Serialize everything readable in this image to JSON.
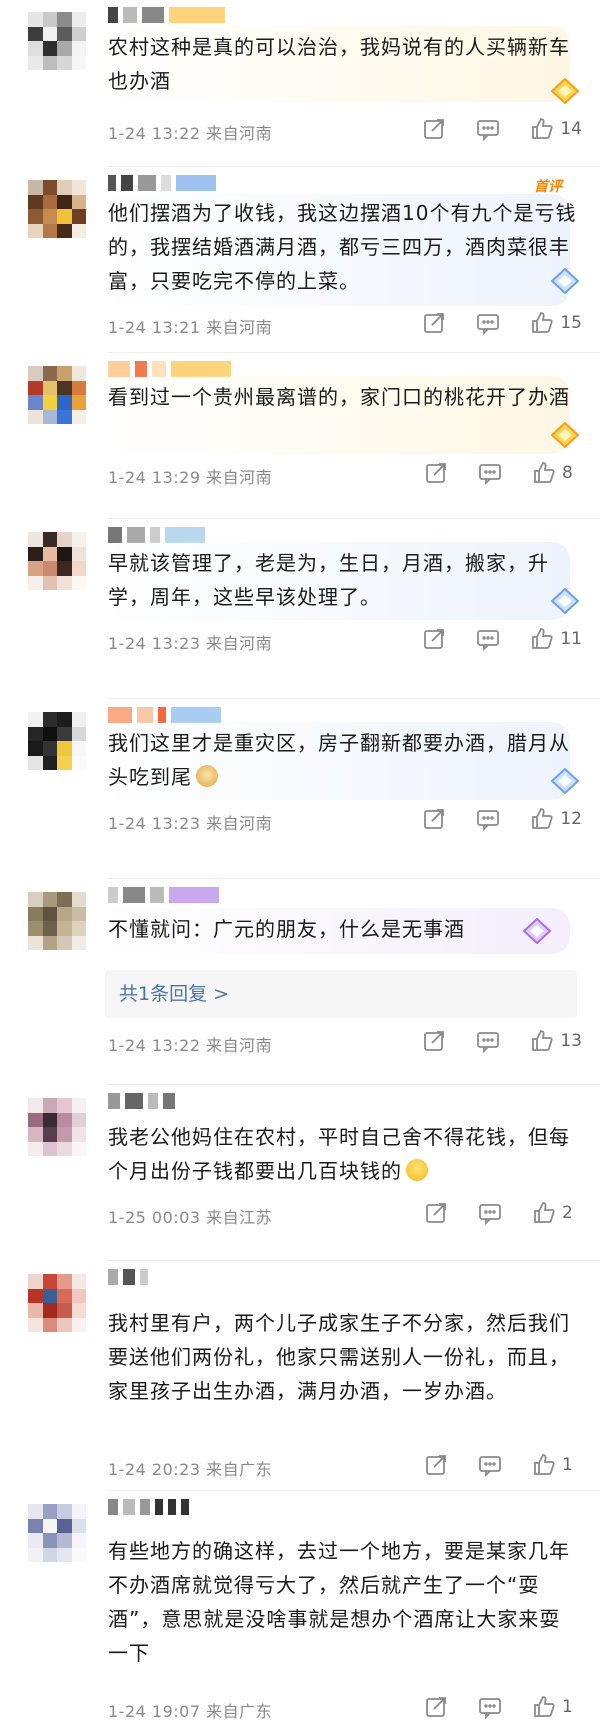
{
  "colors": {
    "hot": "#ff8200",
    "meta": "#8a8a8a",
    "link": "#4b77a8"
  },
  "hot_label": "首评",
  "comments": [
    {
      "text": "农村这种是真的可以治治，我妈说有的人买辆新车也办酒",
      "time": "1-24 13:22",
      "location": "来自河南",
      "likes": "14",
      "badge": "gold-badge-icon"
    },
    {
      "text": "他们摆酒为了收钱，我这边摆酒10个有九个是亏钱的，我摆结婚酒满月酒，都亏三四万，酒肉菜很丰富，只要吃完不停的上菜。",
      "time": "1-24 13:21",
      "location": "来自河南",
      "likes": "15",
      "badge": "diamond-badge-icon"
    },
    {
      "text": "看到过一个贵州最离谱的，家门口的桃花开了办酒",
      "time": "1-24 13:29",
      "location": "来自河南",
      "likes": "8",
      "badge": "gold-badge-icon"
    },
    {
      "text": "早就该管理了，老是为，生日，月酒，搬家，升学，周年，这些早该处理了。",
      "time": "1-24 13:23",
      "location": "来自河南",
      "likes": "11",
      "badge": "diamond-badge-icon"
    },
    {
      "text": "我们这里才是重灾区，房子翻新都要办酒，腊月从头吃到尾",
      "time": "1-24 13:23",
      "location": "来自河南",
      "likes": "12",
      "badge": "diamond-badge-icon"
    },
    {
      "text": "不懂就问：广元的朋友，什么是无事酒",
      "time": "1-24 13:22",
      "location": "来自河南",
      "likes": "13",
      "badge": "purple-badge-icon",
      "replies_label": "共1条回复 >"
    },
    {
      "text": "我老公他妈住在农村，平时自己舍不得花钱，但每个月出份子钱都要出几百块钱的",
      "time": "1-25 00:03",
      "location": "来自江苏",
      "likes": "2"
    },
    {
      "text": "我村里有户，两个儿子成家生子不分家，然后我们要送他们两份礼，他家只需送别人一份礼，而且，家里孩子出生办酒，满月办酒，一岁办酒。",
      "time": "1-24 20:23",
      "location": "来自广东",
      "likes": "1"
    },
    {
      "text": "有些地方的确这样，去过一个地方，要是某家几年不办酒席就觉得亏大了，然后就产生了一个“耍酒”，意思就是没啥事就是想办个酒席让大家来耍一下",
      "time": "1-24 19:07",
      "location": "来自广东",
      "likes": "1"
    }
  ]
}
